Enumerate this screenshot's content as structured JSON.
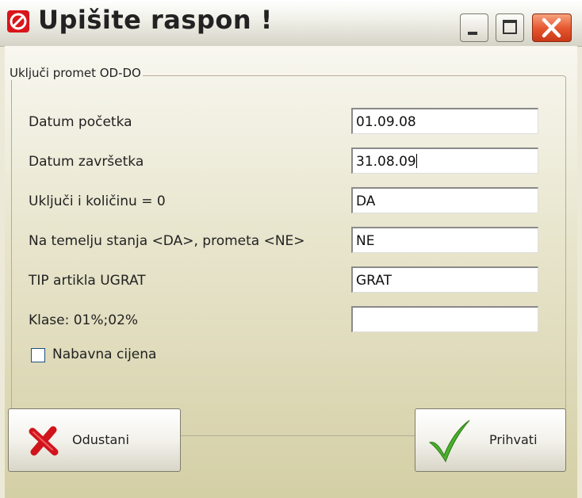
{
  "window": {
    "title": "Upišite raspon !",
    "colors": {
      "titlebar": "#f1f1ea",
      "close_button": "#e4552c",
      "panel": "#ece9d8"
    }
  },
  "group": {
    "label": "Uključi promet OD-DO"
  },
  "fields": [
    {
      "label": "Datum početka",
      "value": "01.09.08"
    },
    {
      "label": "Datum završetka",
      "value": "31.08.09"
    },
    {
      "label": "Uključi i količinu = 0",
      "value": "DA"
    },
    {
      "label": "Na temelju stanja <DA>, prometa <NE>",
      "value": "NE"
    },
    {
      "label": "TIP artikla UGRAT",
      "value": "GRAT"
    },
    {
      "label": "Klase: 01%;02%",
      "value": ""
    }
  ],
  "checkbox": {
    "label": "Nabavna cijena",
    "checked": false
  },
  "buttons": {
    "cancel": {
      "label": "Odustani",
      "icon": "red-x-icon"
    },
    "accept": {
      "label": "Prihvati",
      "icon": "green-checkmark-icon"
    }
  },
  "icons": {
    "app": "red-circle-slash-icon",
    "minimize": "minimize-icon",
    "maximize": "maximize-icon",
    "close": "close-icon"
  }
}
